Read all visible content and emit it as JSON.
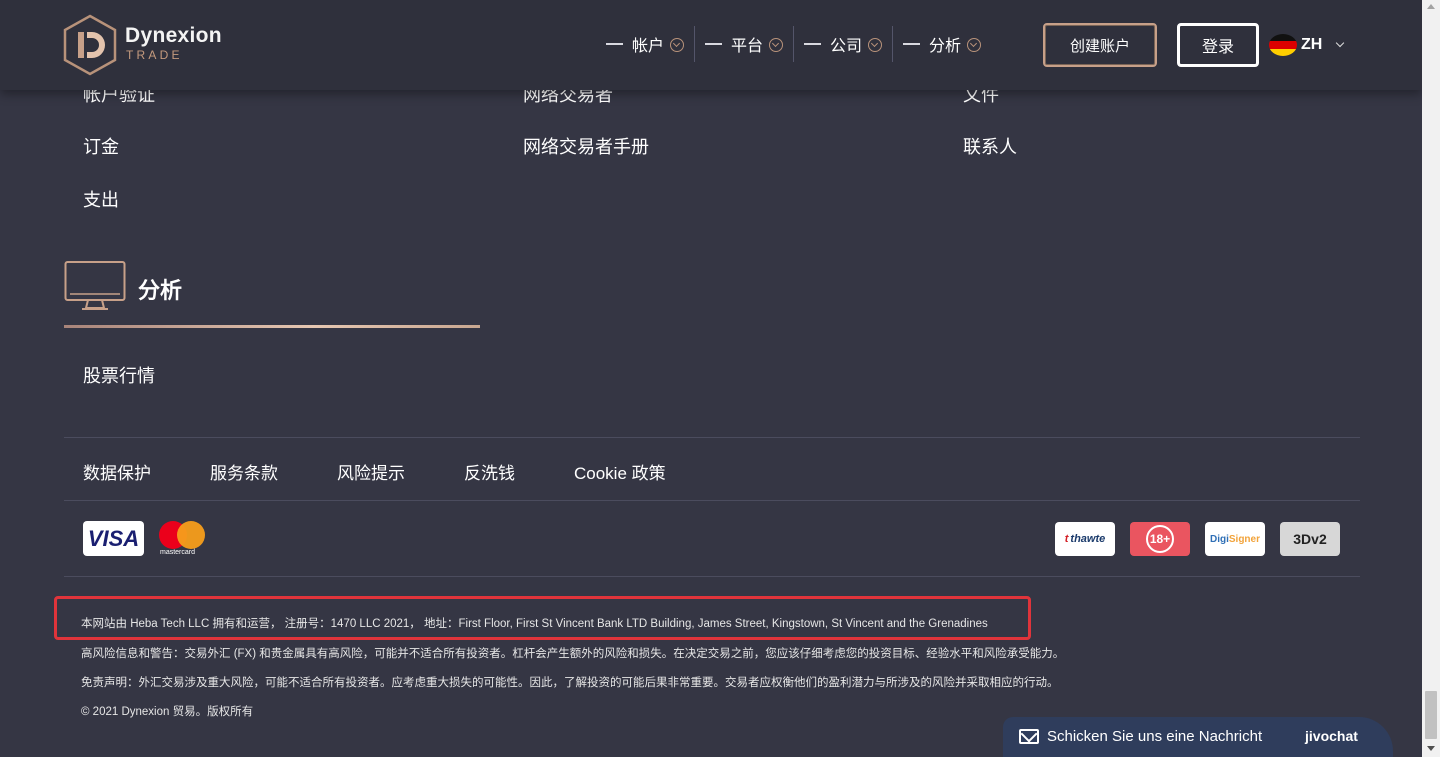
{
  "header": {
    "logo_name": "Dynexion",
    "logo_sub": "TRADE",
    "nav": [
      {
        "label": "帐户"
      },
      {
        "label": "平台"
      },
      {
        "label": "公司"
      },
      {
        "label": "分析"
      }
    ],
    "create_account_label": "创建账户",
    "login_label": "登录",
    "language_code": "ZH"
  },
  "links": {
    "col1": [
      "帐户验证",
      "订金",
      "支出"
    ],
    "col2": [
      "网络交易者",
      "网络交易者手册"
    ],
    "col3": [
      "文件",
      "联系人"
    ]
  },
  "analysis": {
    "title": "分析",
    "items": [
      "股票行情"
    ]
  },
  "footer_links": [
    "数据保护",
    "服务条款",
    "风险提示",
    "反洗钱",
    "Cookie 政策"
  ],
  "payments": {
    "visa": "VISA",
    "mastercard": "mastercard"
  },
  "badges": {
    "thawte_mark": "t",
    "thawte": "thawte",
    "age": "18+",
    "digi_a": "Digi",
    "digi_b": "Signer",
    "three_d": "3Dv2"
  },
  "legal": {
    "ownership": "本网站由 Heba Tech LLC 拥有和运营， 注册号：1470 LLC 2021， 地址：First Floor, First St Vincent Bank LTD Building, James Street, Kingstown, St Vincent and the Grenadines",
    "risk_warning": "高风险信息和警告：交易外汇 (FX) 和贵金属具有高风险，可能并不适合所有投资者。杠杆会产生额外的风险和损失。在决定交易之前，您应该仔细考虑您的投资目标、经验水平和风险承受能力。",
    "disclaimer": "免责声明：外汇交易涉及重大风险，可能不适合所有投资者。应考虑重大损失的可能性。因此，了解投资的可能后果非常重要。交易者应权衡他们的盈利潜力与所涉及的风险并采取相应的行动。",
    "copyright": "© 2021 Dynexion 贸易。版权所有"
  },
  "chat": {
    "label": "Schicken Sie uns eine Nachricht",
    "brand": "jivochat"
  },
  "colors": {
    "background": "#353644",
    "header": "#2f303c",
    "accent": "#c7a089",
    "highlight": "#e0343b"
  }
}
